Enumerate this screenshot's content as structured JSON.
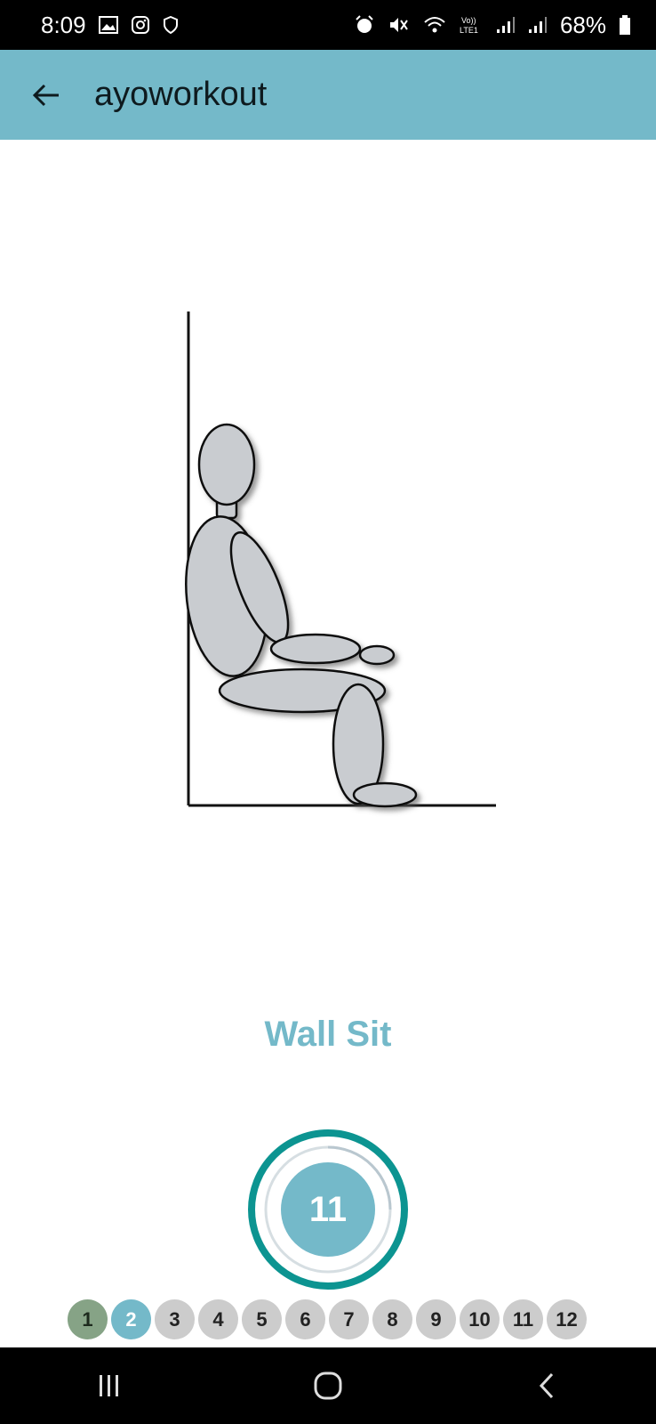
{
  "status": {
    "time": "8:09",
    "battery": "68%",
    "icons_left": [
      "image-icon",
      "instagram-icon",
      "shield-icon"
    ],
    "icons_right": [
      "alarm-icon",
      "mute-icon",
      "wifi-icon",
      "volte-icon",
      "signal-icon",
      "signal-icon",
      "battery-icon"
    ]
  },
  "appbar": {
    "title": "ayoworkout",
    "back_icon": "arrow-left-icon"
  },
  "exercise": {
    "name": "Wall Sit",
    "illustration": "wall-sit-figure"
  },
  "timer": {
    "value": "11"
  },
  "progress": {
    "steps": [
      "1",
      "2",
      "3",
      "4",
      "5",
      "6",
      "7",
      "8",
      "9",
      "10",
      "11",
      "12"
    ],
    "completed_through": 1,
    "current_step": 2
  },
  "colors": {
    "accent": "#74b9c9",
    "teal": "#0c9491",
    "done": "#86a386",
    "pending": "#cccccc"
  },
  "navbar": {
    "icons": [
      "recent-apps-icon",
      "home-icon",
      "back-icon"
    ]
  }
}
